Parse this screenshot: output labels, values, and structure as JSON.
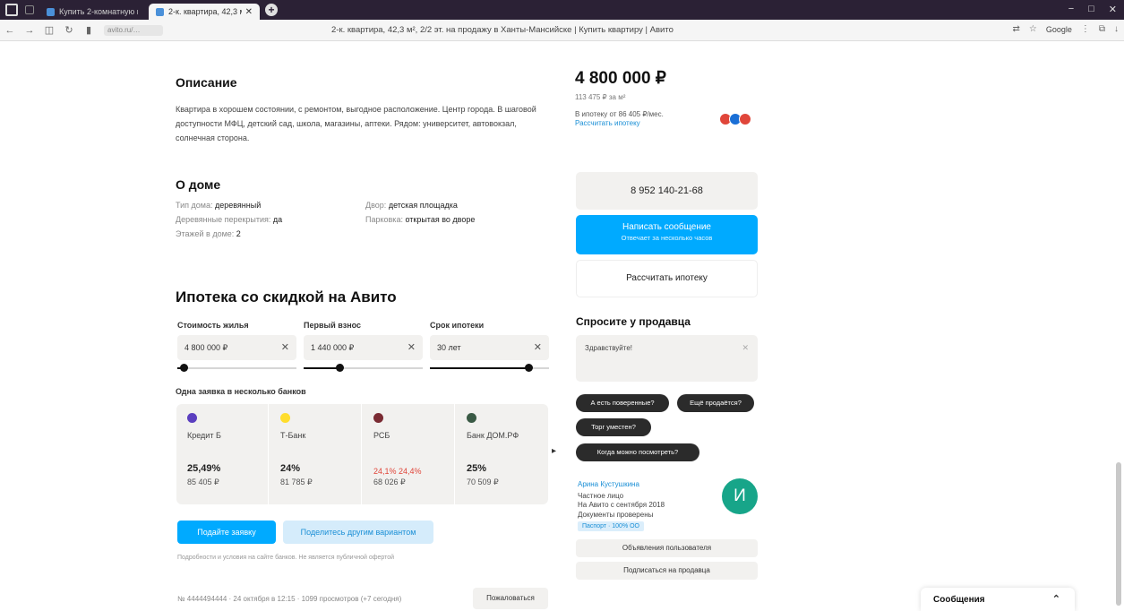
{
  "browser": {
    "tabs": [
      {
        "label": "Купить 2-комнатную кв…",
        "active": false
      },
      {
        "label": "2-к. квартира, 42,3 м²…",
        "active": true
      }
    ],
    "url": "avito.ru/…",
    "page_title": "2-к. квартира, 42,3 м², 2/2 эт. на продажу в Ханты-Мансийске | Купить квартиру | Авито",
    "translate_chip": "Google",
    "window_controls": [
      "−",
      "□",
      "✕"
    ]
  },
  "description": {
    "title": "Описание",
    "text": "Квартира в хорошем состоянии, с ремонтом, выгодное расположение. Центр города. В шаговой доступности МФЦ, детский сад, школа, магазины, аптеки. Рядом: университет, автовокзал, солнечная сторона."
  },
  "house": {
    "title": "О доме",
    "rows": [
      {
        "k": "Тип дома:",
        "v": "деревянный"
      },
      {
        "k": "Деревянные перекрытия:",
        "v": "да"
      },
      {
        "k": "Этажей в доме:",
        "v": "2"
      },
      {
        "k": "Двор:",
        "v": "детская площадка"
      },
      {
        "k": "Парковка:",
        "v": "открытая во дворе"
      }
    ]
  },
  "mortgage": {
    "title": "Ипотека со скидкой на Авито",
    "fields": [
      {
        "label": "Стоимость жилья",
        "value": "4 800 000 ₽",
        "fill": 0.05
      },
      {
        "label": "Первый взнос",
        "value": "1 440 000 ₽",
        "fill": 0.3
      },
      {
        "label": "Срок ипотеки",
        "value": "30 лет",
        "fill": 0.83
      }
    ],
    "banks_label": "Одна заявка в несколько банков",
    "banks": [
      {
        "name": "Кредит Б",
        "rate": "25,49%",
        "payment": "85 405 ₽",
        "logo_color": "#5b3fbf"
      },
      {
        "name": "Т-Банк",
        "rate": "24%",
        "payment": "81 785 ₽",
        "logo_color": "#ffdd2d"
      },
      {
        "name": "РСБ",
        "rate": "24,1% 24,4%",
        "payment": "68 026 ₽",
        "logo_color": "#7a2b33",
        "highlight": true
      },
      {
        "name": "Банк ДОМ.РФ",
        "rate": "25%",
        "payment": "70 509 ₽",
        "logo_color": "#3a5a45"
      }
    ],
    "apply_button": "Подайте заявку",
    "share_button": "Поделитесь другим вариантом",
    "legal": "Подробности и условия на сайте банков. Не является публичной офертой"
  },
  "footer": {
    "line": "№ 4444494444 · 24 октября в 12:15 · 1099 просмотров (+7 сегодня)",
    "complain_button": "Пожаловаться"
  },
  "sidebar": {
    "price": "4 800 000 ₽",
    "price_per_m": "113 475 ₽ за м²",
    "mortgage_note": "В ипотеку от 86 405 ₽/мес.",
    "mortgage_link": "Рассчитать ипотеку",
    "pay_icon_colors": [
      "#e0463a",
      "#1a6fd6",
      "#e0463a"
    ],
    "phone_button": "8 952 140-21-68",
    "message_button": "Написать сообщение",
    "message_sub": "Отвечает за несколько часов",
    "calc_button": "Рассчитать ипотеку",
    "ask_title": "Спросите у продавца",
    "ask_placeholder": "Здравствуйте!",
    "chips": [
      "А есть поверенные?",
      "Ещё продаётся?",
      "Торг уместен?",
      "Когда можно посмотреть?"
    ],
    "seller": {
      "name": "Арина Кустушкина",
      "type": "Частное лицо",
      "since": "На Авито с сентября 2018",
      "doc": "Документы проверены",
      "badge": "Паспорт · 100% ОО",
      "avatar_letter": "И",
      "buttons": [
        "Объявления пользователя",
        "Подписаться на продавца"
      ]
    }
  },
  "messages_widget": {
    "label": "Сообщения"
  }
}
